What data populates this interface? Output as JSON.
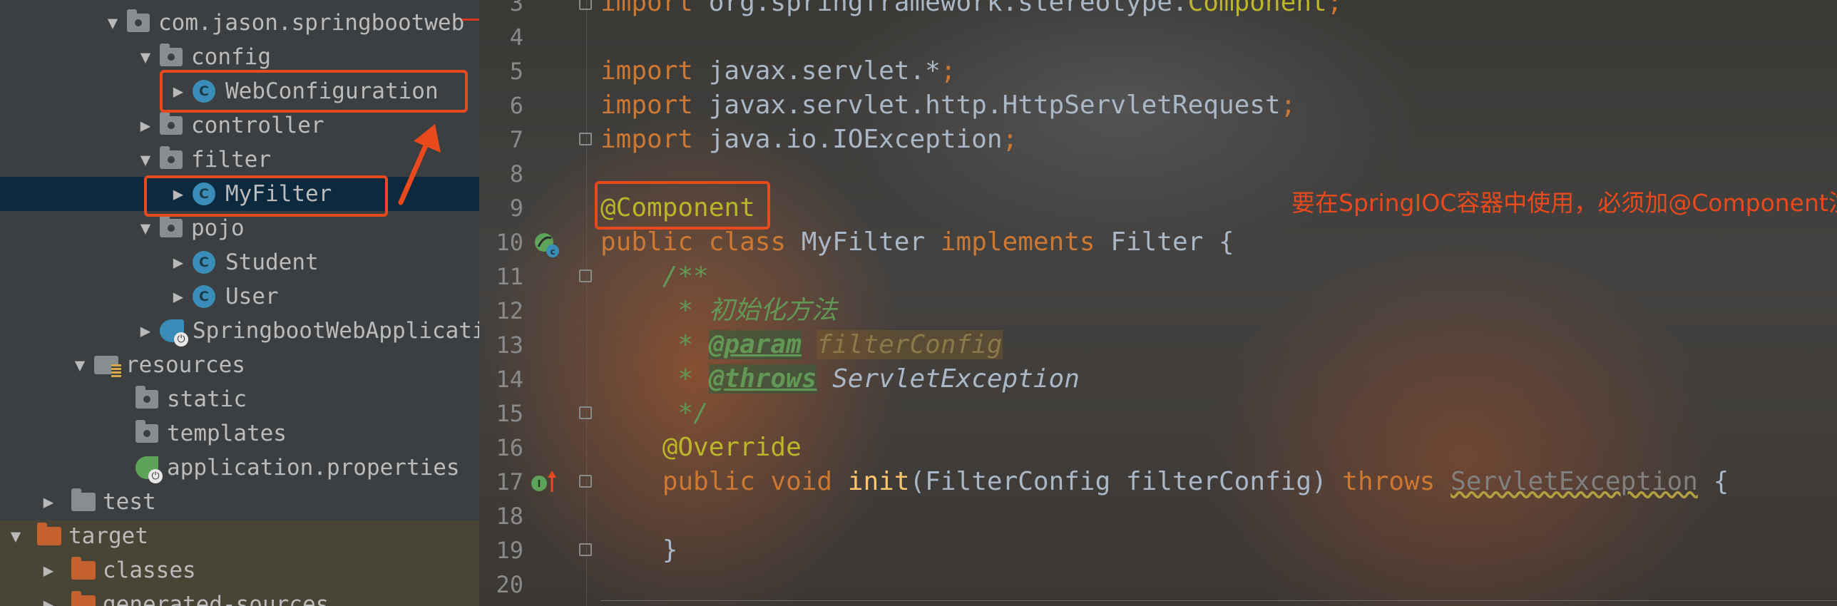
{
  "project_tree": {
    "items": [
      {
        "label": "com.jason.springbootweb",
        "kind": "package",
        "expanded": true
      },
      {
        "label": "config",
        "kind": "package",
        "expanded": true
      },
      {
        "label": "WebConfiguration",
        "kind": "class",
        "expanded": false,
        "icon_letter": "C"
      },
      {
        "label": "controller",
        "kind": "package",
        "expanded": false
      },
      {
        "label": "filter",
        "kind": "package",
        "expanded": true
      },
      {
        "label": "MyFilter",
        "kind": "class",
        "expanded": false,
        "icon_letter": "C",
        "selected": true
      },
      {
        "label": "pojo",
        "kind": "package",
        "expanded": true
      },
      {
        "label": "Student",
        "kind": "class",
        "expanded": false,
        "icon_letter": "C"
      },
      {
        "label": "User",
        "kind": "class",
        "expanded": false,
        "icon_letter": "C"
      },
      {
        "label": "SpringbootWebApplicati",
        "kind": "spring-boot-class",
        "expanded": false
      },
      {
        "label": "resources",
        "kind": "resources-folder",
        "expanded": true
      },
      {
        "label": "static",
        "kind": "folder"
      },
      {
        "label": "templates",
        "kind": "folder"
      },
      {
        "label": "application.properties",
        "kind": "properties-file"
      },
      {
        "label": "test",
        "kind": "folder",
        "expanded": false
      },
      {
        "label": "target",
        "kind": "excluded-folder",
        "expanded": true
      },
      {
        "label": "classes",
        "kind": "excluded-folder",
        "expanded": false
      },
      {
        "label": "generated-sources",
        "kind": "excluded-folder",
        "expanded": false
      }
    ]
  },
  "editor": {
    "line_numbers": [
      "3",
      "4",
      "5",
      "6",
      "7",
      "8",
      "9",
      "10",
      "11",
      "12",
      "13",
      "14",
      "15",
      "16",
      "17",
      "18",
      "19",
      "20"
    ],
    "code": {
      "l3_kw": "import",
      "l3_pkg": " org.springframework.stereotype.",
      "l3_cls": "Component",
      "l5_kw": "import",
      "l5_pkg": " javax.servlet.*",
      "l6_kw": "import",
      "l6_pkg": " javax.servlet.http.HttpServletRequest",
      "l7_kw": "import",
      "l7_pkg": " java.io.IOException",
      "semicolon": ";",
      "l9_ann": "@Component",
      "l10_kw1": "public class",
      "l10_name": " MyFilter ",
      "l10_kw2": "implements",
      "l10_rest": " Filter {",
      "l11": "    /**",
      "l12": "     * 初始化方法",
      "l13_star": "     * ",
      "l13_tag": "@param",
      "l13_sp": " ",
      "l13_ref": "filterConfig",
      "l14_star": "     * ",
      "l14_tag": "@throws",
      "l14_sp": " ",
      "l14_ref": "ServletException",
      "l15": "     */",
      "l16_ann": "    @Override",
      "l17_kw": "    public void",
      "l17_sp": " ",
      "l17_fn": "init",
      "l17_args": "(FilterConfig filterConfig) ",
      "l17_throws": "throws",
      "l17_sp2": " ",
      "l17_exc": "ServletException",
      "l17_end": " {",
      "l19": "    }"
    },
    "note": "要在SpringIOC容器中使用，必须加@Component注解"
  },
  "colors": {
    "annotation_red": "#e8491d",
    "keyword": "#cc7832",
    "annotation": "#bbb529",
    "comment": "#629755",
    "method": "#ffc66d",
    "text": "#a9b7c6"
  }
}
